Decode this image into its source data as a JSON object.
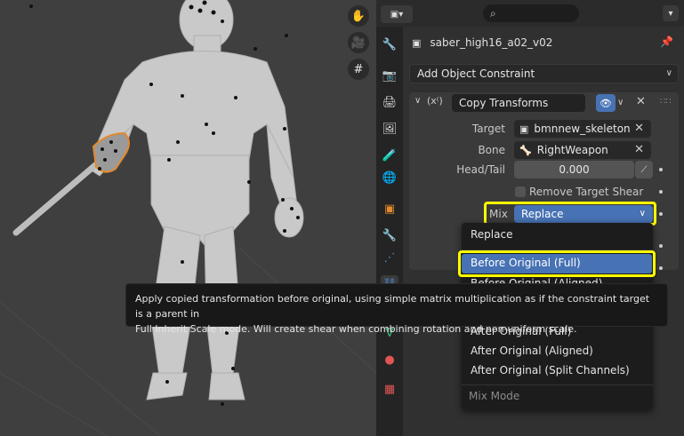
{
  "viewport": {
    "tool_icons": [
      "hand-icon",
      "camera-icon",
      "grid-icon"
    ]
  },
  "properties": {
    "object_name": "saber_high16_a02_v02",
    "add_constraint_label": "Add Object Constraint",
    "constraint": {
      "name": "Copy Transforms",
      "target_label": "Target",
      "target_value": "bmnnew_skeleton",
      "bone_label": "Bone",
      "bone_value": "RightWeapon",
      "head_tail_label": "Head/Tail",
      "head_tail_value": "0.000",
      "remove_shear_label": "Remove Target Shear",
      "mix_label": "Mix",
      "mix_value": "Replace"
    }
  },
  "mix_menu": {
    "items": [
      "Replace",
      "Before Original (Full)",
      "Before Original (Aligned)",
      "After Original (Full)",
      "After Original (Aligned)",
      "After Original (Split Channels)"
    ],
    "footer": "Mix Mode"
  },
  "tooltip": {
    "line1": "Apply copied transformation before original, using simple matrix multiplication as if the constraint target is a parent in",
    "line2": "Full Inherit Scale mode. Will create shear when combining rotation and non-uniform scale."
  },
  "colors": {
    "accent": "#4772b3",
    "highlight": "#ffff00",
    "selection_outline": "#e38b2b"
  }
}
